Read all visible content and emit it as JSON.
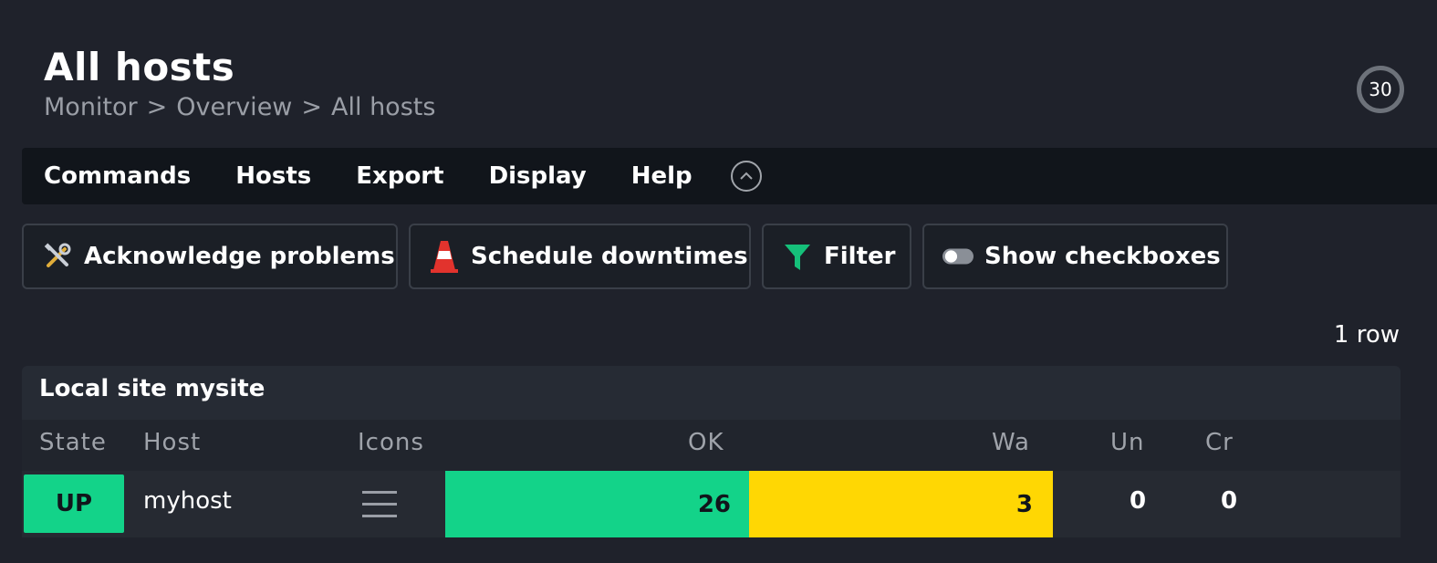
{
  "header": {
    "title": "All hosts",
    "breadcrumb": [
      "Monitor",
      ">",
      "Overview",
      ">",
      "All hosts"
    ],
    "refresh_counter": "30"
  },
  "menubar": {
    "items": [
      "Commands",
      "Hosts",
      "Export",
      "Display",
      "Help"
    ]
  },
  "shortcuts": [
    {
      "label": "Acknowledge problems",
      "icon": "wrench-screwdriver-icon"
    },
    {
      "label": "Schedule downtimes",
      "icon": "traffic-cone-icon"
    },
    {
      "label": "Filter",
      "icon": "funnel-icon"
    },
    {
      "label": "Show checkboxes",
      "icon": "toggle-icon"
    }
  ],
  "table": {
    "row_count": "1 row",
    "group_title": "Local site mysite",
    "columns": [
      "State",
      "Host",
      "Icons",
      "OK",
      "Wa",
      "Un",
      "Cr"
    ],
    "rows": [
      {
        "state": "UP",
        "host": "myhost",
        "ok": "26",
        "warn": "3",
        "unknown": "0",
        "critical": "0"
      }
    ]
  },
  "colors": {
    "background": "#1f222b",
    "ok": "#13d389",
    "warn": "#ffd703",
    "menubar": "#11151b"
  }
}
